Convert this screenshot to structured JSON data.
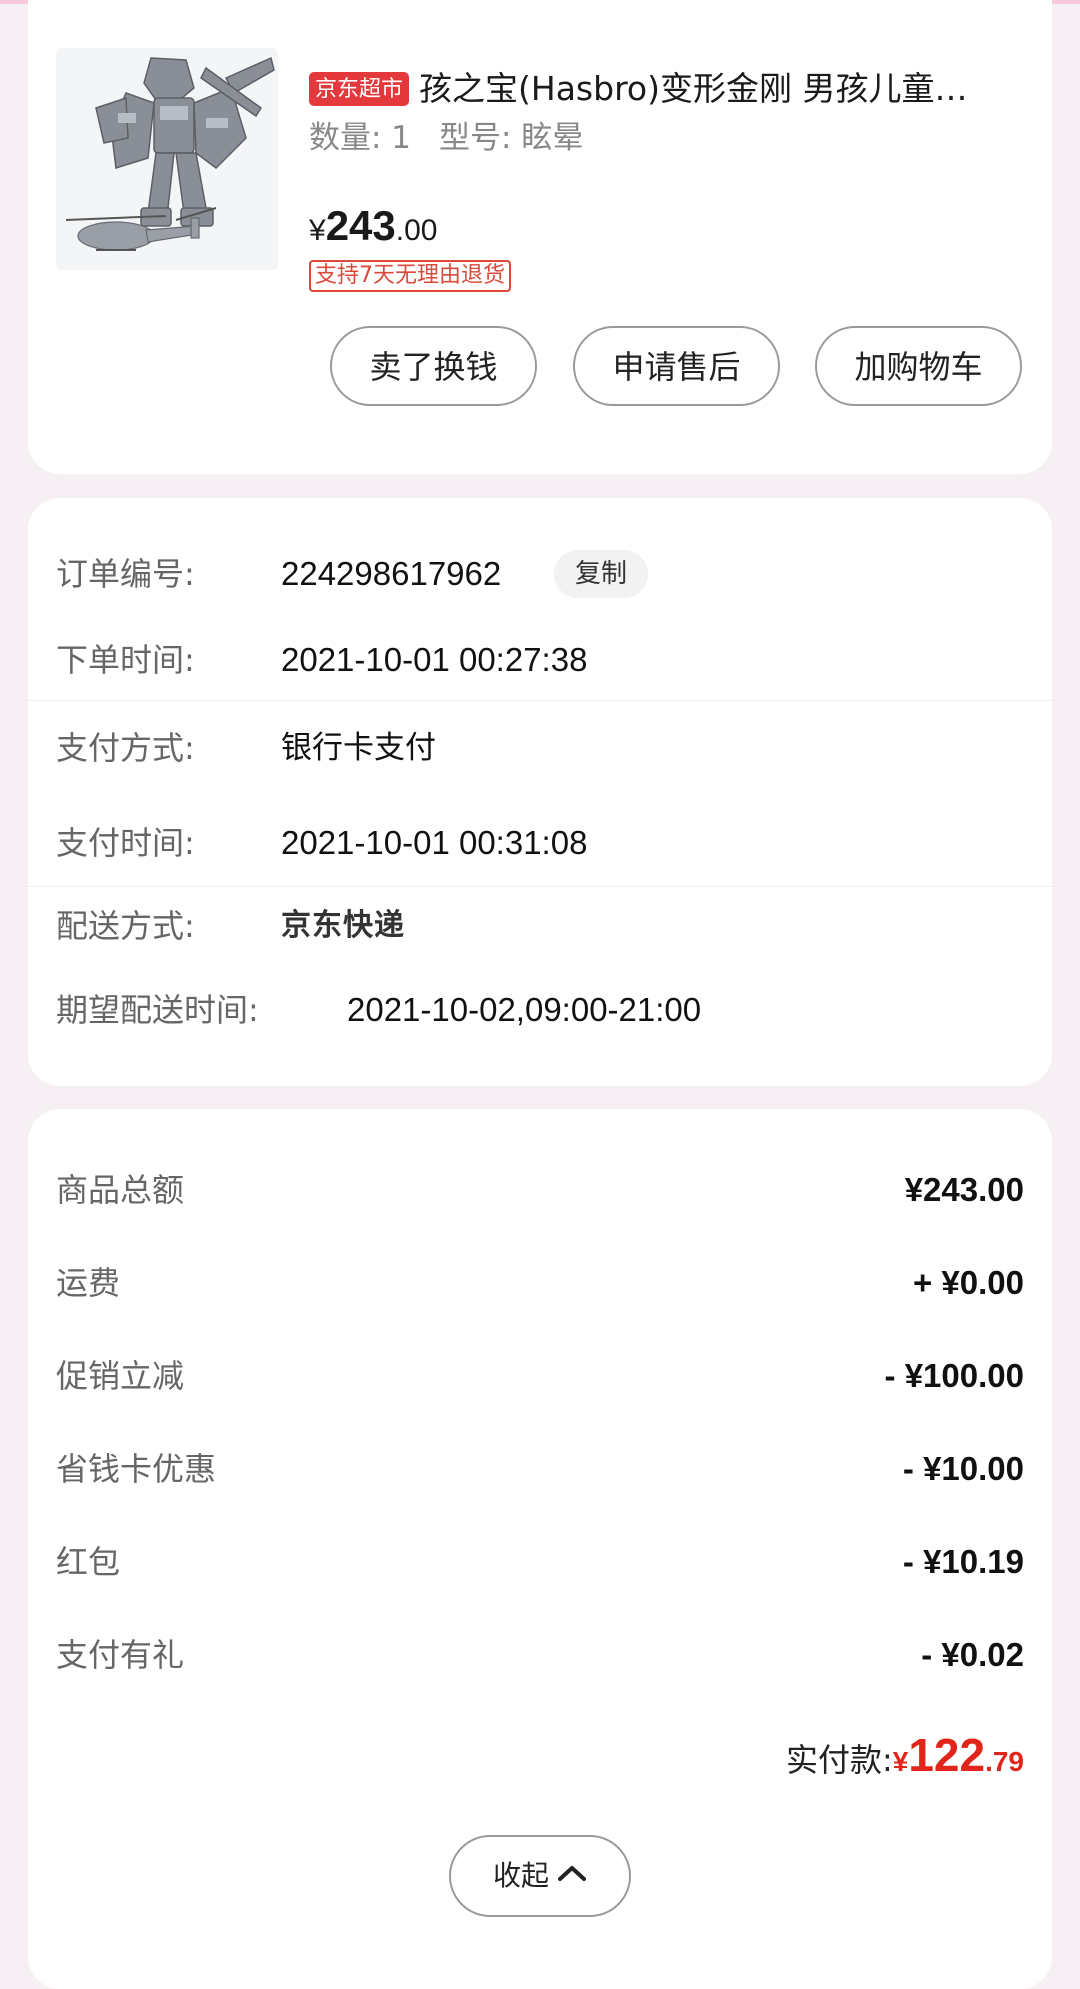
{
  "product": {
    "store_badge": "京东超市",
    "title": "孩之宝(Hasbro)变形金刚 男孩儿童…",
    "quantity": "数量: 1",
    "model": "型号: 眩晕",
    "price_currency": "¥",
    "price_integer": "243",
    "price_decimal": ".00",
    "return_policy": "支持7天无理由退货",
    "image_icon": "transformer-toy-photo"
  },
  "actions": {
    "sell_label": "卖了换钱",
    "after_sales_label": "申请售后",
    "add_cart_label": "加购物车"
  },
  "order": {
    "order_no_label": "订单编号:",
    "order_no": "224298617962",
    "copy_label": "复制",
    "order_time_label": "下单时间:",
    "order_time": "2021-10-01 00:27:38",
    "pay_method_label": "支付方式:",
    "pay_method": "银行卡支付",
    "pay_time_label": "支付时间:",
    "pay_time": "2021-10-01 00:31:08",
    "delivery_label": "配送方式:",
    "delivery": "京东快递",
    "expected_label": "期望配送时间:",
    "expected": "2021-10-02,09:00-21:00"
  },
  "fees": [
    {
      "label": "商品总额",
      "amount": "¥243.00"
    },
    {
      "label": "运费",
      "amount": "+ ¥0.00"
    },
    {
      "label": "促销立减",
      "amount": "- ¥100.00"
    },
    {
      "label": "省钱卡优惠",
      "amount": "- ¥10.00"
    },
    {
      "label": "红包",
      "amount": "- ¥10.19"
    },
    {
      "label": "支付有礼",
      "amount": "- ¥0.02"
    }
  ],
  "paid": {
    "label": "实付款:",
    "currency": "¥",
    "integer": "122",
    "decimal": ".79"
  },
  "collapse": {
    "label": "收起",
    "icon": "chevron-up-icon"
  },
  "colors": {
    "accent": "#e1251b",
    "background": "#f6eff3"
  }
}
